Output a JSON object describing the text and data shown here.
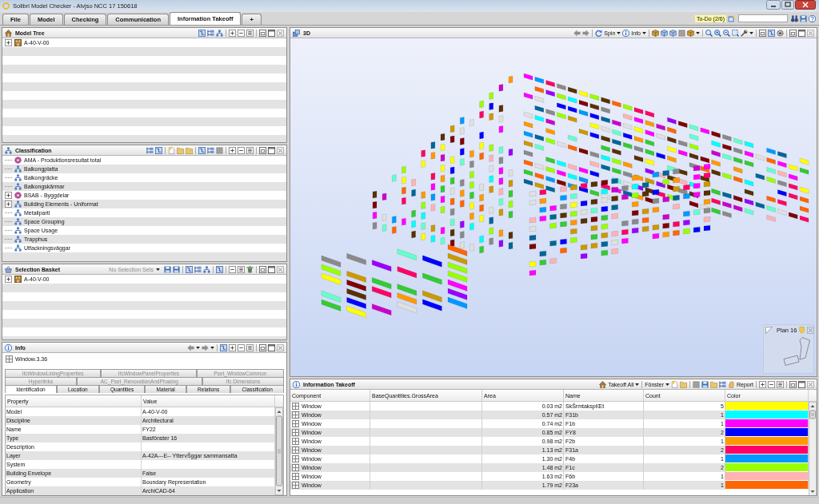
{
  "window": {
    "title": "Solibri Model Checker - Alvjso NCC 17 150618"
  },
  "tabs": [
    {
      "label": "File",
      "selected": false
    },
    {
      "label": "Model",
      "selected": false
    },
    {
      "label": "Checking",
      "selected": false
    },
    {
      "label": "Communication",
      "selected": false
    },
    {
      "label": "Information Takeoff",
      "selected": true
    },
    {
      "label": "+",
      "selected": false
    }
  ],
  "todo": {
    "label": "To-Do (2/6)"
  },
  "model_tree": {
    "title": "Model Tree",
    "items": [
      {
        "label": "A-40-V-00",
        "expandable": true
      }
    ]
  },
  "classification": {
    "title": "Classification",
    "items": [
      {
        "label": "AMA - Produktionsresultat total",
        "kind": "scheme",
        "expandable": false
      },
      {
        "label": "Balkongplatta",
        "kind": "group",
        "expandable": false
      },
      {
        "label": "Balkongräcke",
        "kind": "group",
        "expandable": false
      },
      {
        "label": "Balkongskärmar",
        "kind": "group",
        "expandable": false
      },
      {
        "label": "BSAB - Byggdelar",
        "kind": "scheme",
        "expandable": true
      },
      {
        "label": "Building Elements - Uniformat",
        "kind": "group",
        "expandable": true
      },
      {
        "label": "Metallparti",
        "kind": "group",
        "expandable": false
      },
      {
        "label": "Space Grouping",
        "kind": "group",
        "expandable": false
      },
      {
        "label": "Space Usage",
        "kind": "group",
        "expandable": false
      },
      {
        "label": "Trapphus",
        "kind": "group",
        "expandable": false
      },
      {
        "label": "Utfackningsväggar",
        "kind": "group",
        "expandable": false
      }
    ]
  },
  "selection_basket": {
    "title": "Selection Basket",
    "selection_sets": {
      "label": "No Selection Sets",
      "disabled": true
    },
    "items": [
      {
        "label": "A-40-V-00",
        "expandable": true
      }
    ]
  },
  "info": {
    "title": "Info",
    "object": "Window.3.36",
    "tab_rows": [
      [
        {
          "label": "IfcWindowLiningProperties",
          "selected": false,
          "disabled": true
        },
        {
          "label": "IfcWindowPanelProperties",
          "selected": false,
          "disabled": true
        },
        {
          "label": "Pset_WindowCommon",
          "selected": false,
          "disabled": true
        }
      ],
      [
        {
          "label": "Hyperlinks",
          "selected": false,
          "disabled": true
        },
        {
          "label": "AC_Pset_RenovationAndPhasing",
          "selected": false,
          "disabled": true
        },
        {
          "label": "Ifc Dimensions",
          "selected": false,
          "disabled": true
        }
      ],
      [
        {
          "label": "Identification",
          "selected": true,
          "disabled": false
        },
        {
          "label": "Location",
          "selected": false,
          "disabled": false
        },
        {
          "label": "Quantities",
          "selected": false,
          "disabled": false
        },
        {
          "label": "Material",
          "selected": false,
          "disabled": false
        },
        {
          "label": "Relations",
          "selected": false,
          "disabled": false
        },
        {
          "label": "Classification",
          "selected": false,
          "disabled": false
        }
      ]
    ],
    "columns": [
      "Property",
      "Value"
    ],
    "rows": [
      {
        "property": "Model",
        "value": "A-40-V-00"
      },
      {
        "property": "Discipline",
        "value": "Architectural"
      },
      {
        "property": "Name",
        "value": "FY22"
      },
      {
        "property": "Type",
        "value": "Basfönster 16"
      },
      {
        "property": "Description"
      },
      {
        "property": "Layer",
        "value": "A-42A---E-- YttervŠggar sammansatta"
      },
      {
        "property": "System"
      },
      {
        "property": "Building Envelope",
        "value": "False"
      },
      {
        "property": "Geometry",
        "value": "Boundary Representation"
      },
      {
        "property": "Application",
        "value": "ArchiCAD-64"
      }
    ]
  },
  "view_3d": {
    "title": "3D",
    "spin": "Spin",
    "info": "Info",
    "plan_view": "Plan 16"
  },
  "takeoff": {
    "title": "Information Takeoff",
    "takeoff_button": "Takeoff All",
    "filter": "Fönster",
    "report": "Report",
    "columns": [
      "Component",
      "BaseQuantities.GrossArea",
      "Area",
      "Name",
      "Count",
      "Color"
    ],
    "rows": [
      {
        "component": "Window",
        "area": "0.03 m2",
        "name": "SkŠrmtaksplŒt",
        "count": "5",
        "color": "#ffff00"
      },
      {
        "component": "Window",
        "area": "0.57 m2",
        "name": "F31b",
        "count": "1",
        "color": "#00ffff"
      },
      {
        "component": "Window",
        "area": "0.74 m2",
        "name": "F1b",
        "count": "1",
        "color": "#ff00ff"
      },
      {
        "component": "Window",
        "area": "0.85 m2",
        "name": "FY8",
        "count": "2",
        "color": "#0000ff"
      },
      {
        "component": "Window",
        "area": "0.98 m2",
        "name": "F2b",
        "count": "1",
        "color": "#ff9900"
      },
      {
        "component": "Window",
        "area": "1.13 m2",
        "name": "F31a",
        "count": "2",
        "color": "#ff0066"
      },
      {
        "component": "Window",
        "area": "1.30 m2",
        "name": "F4b",
        "count": "1",
        "color": "#0099ff"
      },
      {
        "component": "Window",
        "area": "1.48 m2",
        "name": "F1c",
        "count": "2",
        "color": "#99ff00"
      },
      {
        "component": "Window",
        "area": "1.63 m2",
        "name": "F6b",
        "count": "1",
        "color": "#ffb3b3"
      },
      {
        "component": "Window",
        "area": "1.79 m2",
        "name": "F23a",
        "count": "1",
        "color": "#ff6600"
      }
    ]
  }
}
